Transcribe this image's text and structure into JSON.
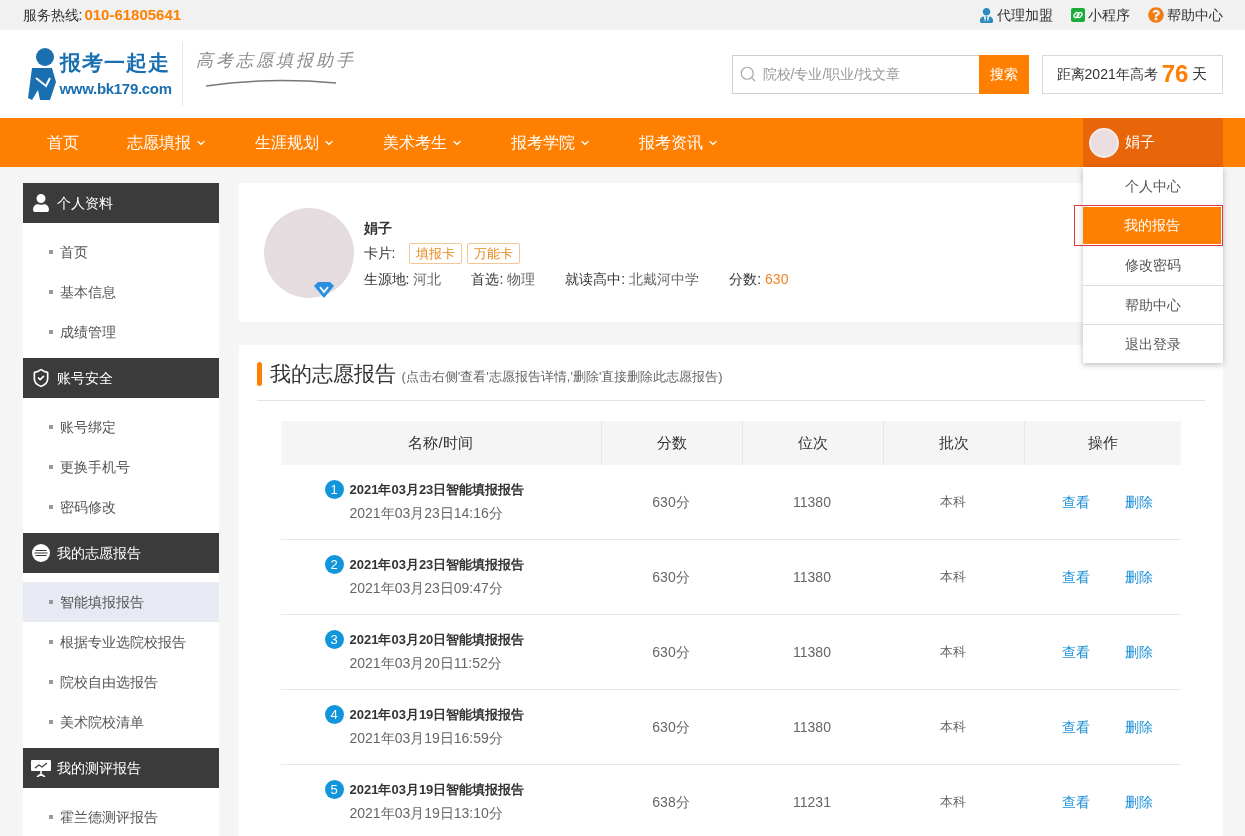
{
  "top_bar": {
    "hotline_label": "服务热线:",
    "hotline_number": "010-61805641",
    "links": [
      {
        "kind": "agent",
        "label": "代理加盟"
      },
      {
        "kind": "mini_program",
        "label": "小程序"
      },
      {
        "kind": "help",
        "label": "帮助中心"
      }
    ]
  },
  "header": {
    "logo": {
      "name": "报考一起走",
      "url": "www.bk179.com"
    },
    "slogan": "高考志愿填报助手",
    "search": {
      "placeholder": "院校/专业/职业/找文章",
      "button": "搜索"
    },
    "countdown": {
      "prefix": "距离2021年高考",
      "days": "76",
      "unit": "天"
    }
  },
  "nav": {
    "items": [
      {
        "label": "首页",
        "has_menu": false
      },
      {
        "label": "志愿填报",
        "has_menu": true
      },
      {
        "label": "生涯规划",
        "has_menu": true
      },
      {
        "label": "美术考生",
        "has_menu": true
      },
      {
        "label": "报考学院",
        "has_menu": true
      },
      {
        "label": "报考资讯",
        "has_menu": true
      }
    ],
    "user": {
      "name": "娟子",
      "menu_open": true,
      "menu": [
        {
          "label": "个人中心",
          "selected": false
        },
        {
          "label": "我的报告",
          "selected": true
        },
        {
          "label": "修改密码",
          "selected": false
        },
        {
          "label": "帮助中心",
          "selected": false
        },
        {
          "label": "退出登录",
          "selected": false
        }
      ]
    }
  },
  "sidebar": {
    "groups": [
      {
        "kind": "profile",
        "title": "个人资料",
        "items": [
          {
            "label": "首页",
            "selected": false
          },
          {
            "label": "基本信息",
            "selected": false
          },
          {
            "label": "成绩管理",
            "selected": false
          }
        ]
      },
      {
        "kind": "security",
        "title": "账号安全",
        "items": [
          {
            "label": "账号绑定",
            "selected": false
          },
          {
            "label": "更换手机号",
            "selected": false
          },
          {
            "label": "密码修改",
            "selected": false
          }
        ]
      },
      {
        "kind": "reports",
        "title": "我的志愿报告",
        "items": [
          {
            "label": "智能填报报告",
            "selected": true
          },
          {
            "label": "根据专业选院校报告",
            "selected": false
          },
          {
            "label": "院校自由选报告",
            "selected": false
          },
          {
            "label": "美术院校清单",
            "selected": false
          }
        ]
      },
      {
        "kind": "assessments",
        "title": "我的测评报告",
        "items": [
          {
            "label": "霍兰德测评报告",
            "selected": false
          }
        ]
      }
    ]
  },
  "profile": {
    "name": "娟子",
    "verified": true,
    "cards_label": "卡片:",
    "cards": [
      "填报卡",
      "万能卡"
    ],
    "fields": [
      {
        "label": "生源地:",
        "value": "河北",
        "highlight": false
      },
      {
        "label": "首选:",
        "value": "物理",
        "highlight": false
      },
      {
        "label": "就读高中:",
        "value": "北戴河中学",
        "highlight": false
      },
      {
        "label": "分数:",
        "value": "630",
        "highlight": true
      }
    ]
  },
  "reports": {
    "title": "我的志愿报告",
    "hint": "(点击右侧'查看'志愿报告详情,'删除'直接删除此志愿报告)",
    "columns": [
      "名称/时间",
      "分数",
      "位次",
      "批次",
      "操作"
    ],
    "rows": [
      {
        "index": "1",
        "title": "2021年03月23日智能填报报告",
        "time": "2021年03月23日14:16分",
        "score": "630分",
        "rank": "11380",
        "batch": "本科",
        "actions": [
          "查看",
          "删除"
        ]
      },
      {
        "index": "2",
        "title": "2021年03月23日智能填报报告",
        "time": "2021年03月23日09:47分",
        "score": "630分",
        "rank": "11380",
        "batch": "本科",
        "actions": [
          "查看",
          "删除"
        ]
      },
      {
        "index": "3",
        "title": "2021年03月20日智能填报报告",
        "time": "2021年03月20日11:52分",
        "score": "630分",
        "rank": "11380",
        "batch": "本科",
        "actions": [
          "查看",
          "删除"
        ]
      },
      {
        "index": "4",
        "title": "2021年03月19日智能填报报告",
        "time": "2021年03月19日16:59分",
        "score": "630分",
        "rank": "11380",
        "batch": "本科",
        "actions": [
          "查看",
          "删除"
        ]
      },
      {
        "index": "5",
        "title": "2021年03月19日智能填报报告",
        "time": "2021年03月19日13:10分",
        "score": "638分",
        "rank": "11231",
        "batch": "本科",
        "actions": [
          "查看",
          "删除"
        ]
      }
    ]
  }
}
